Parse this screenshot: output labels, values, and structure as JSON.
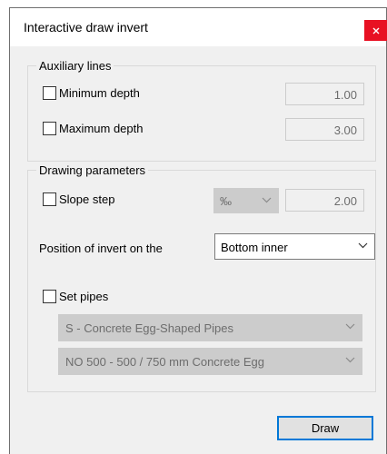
{
  "window": {
    "title": "Interactive draw invert",
    "close_glyph": "x"
  },
  "auxiliary": {
    "legend": "Auxiliary lines",
    "min_label": "Minimum depth",
    "min_value": "1.00",
    "max_label": "Maximum depth",
    "max_value": "3.00"
  },
  "drawing": {
    "legend": "Drawing parameters",
    "slope_label": "Slope step",
    "slope_unit": "‰",
    "slope_value": "2.00",
    "position_label": "Position of invert on the",
    "position_value": "Bottom inner",
    "pipes_label": "Set pipes",
    "pipe_type": "S - Concrete Egg-Shaped Pipes",
    "pipe_size": "NO 500 - 500 / 750 mm Concrete Egg"
  },
  "actions": {
    "draw_label": "Draw"
  },
  "colors": {
    "close_bg": "#e81123",
    "accent": "#0078d7"
  }
}
